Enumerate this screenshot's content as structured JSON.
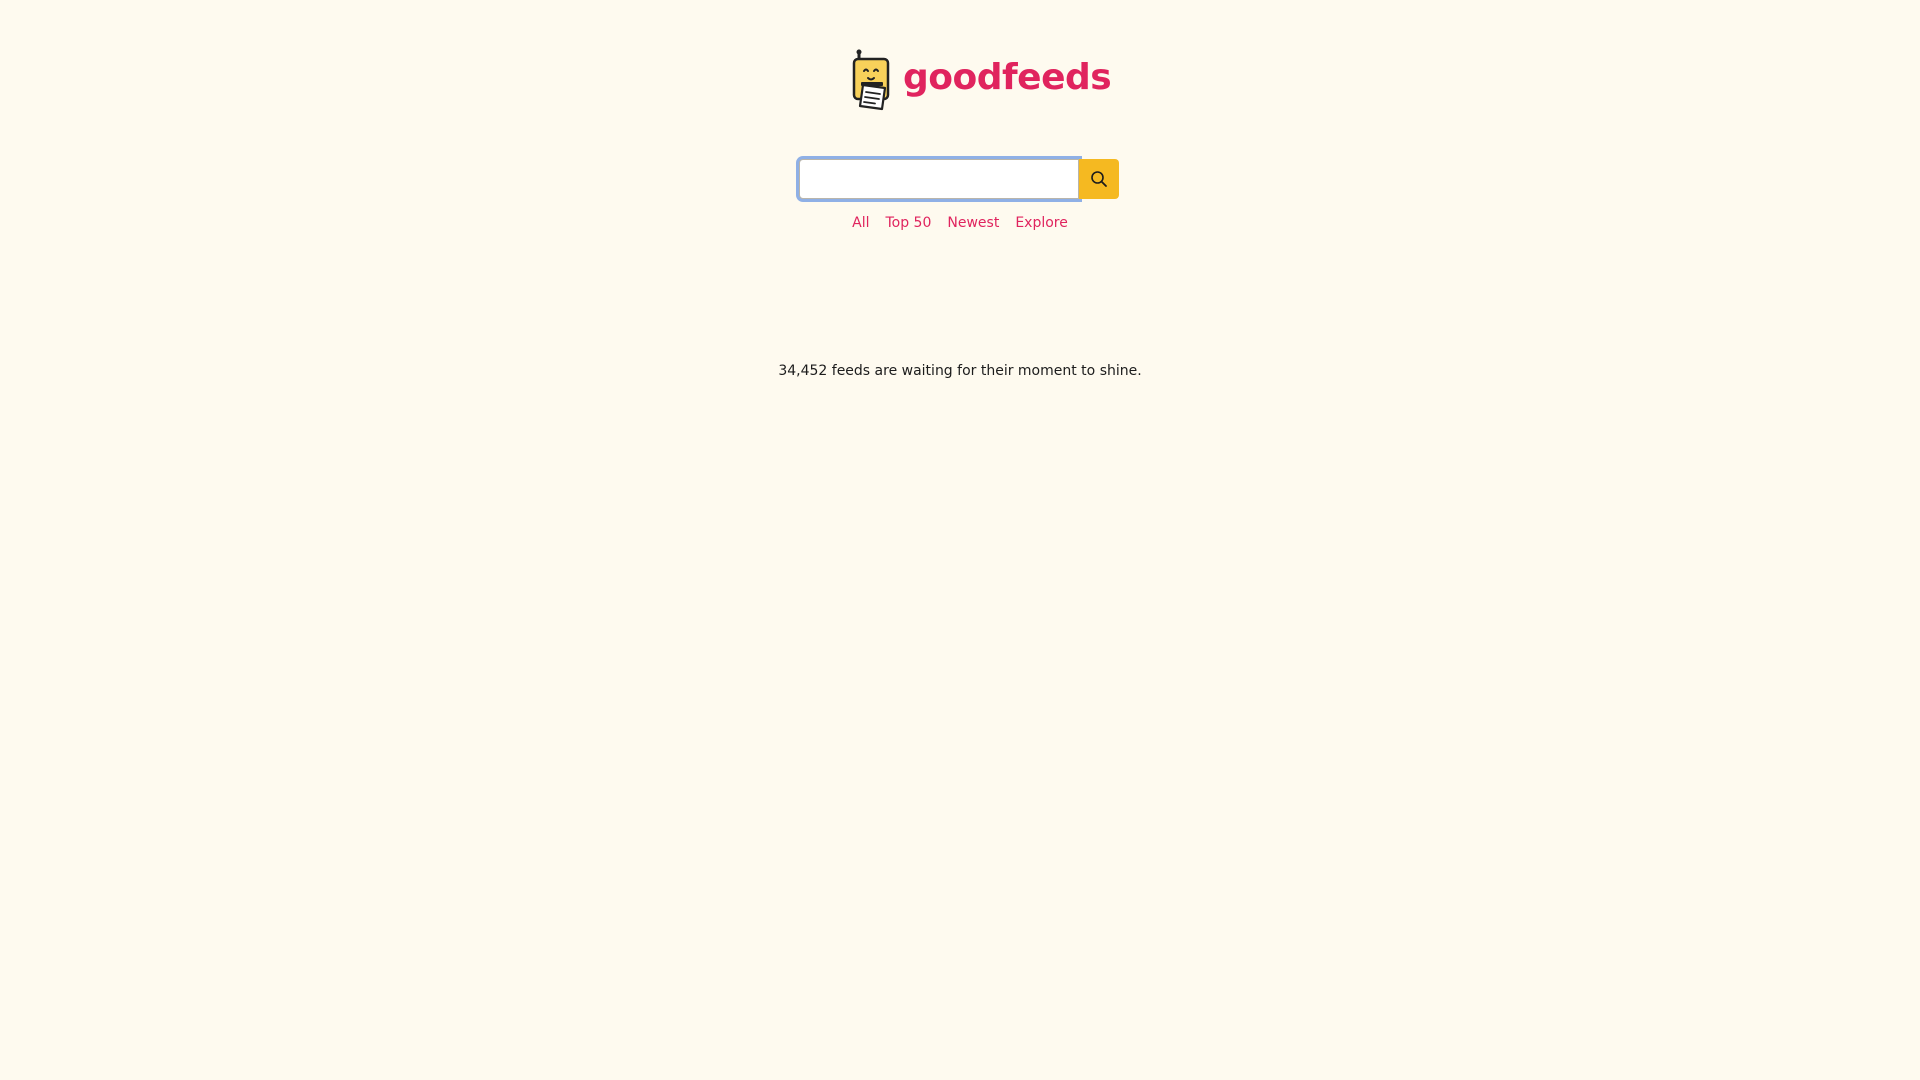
{
  "brand": {
    "name": "goodfeeds",
    "logo_icon": "robot-mascot-icon",
    "accent_color": "#e0245e",
    "button_color": "#f5b921"
  },
  "search": {
    "value": "",
    "placeholder": "",
    "button_icon": "search-icon"
  },
  "nav": {
    "items": [
      {
        "label": "All"
      },
      {
        "label": "Top 50"
      },
      {
        "label": "Newest"
      },
      {
        "label": "Explore"
      }
    ]
  },
  "tagline": {
    "count": "34,452",
    "text": " feeds are waiting for their moment to shine."
  }
}
